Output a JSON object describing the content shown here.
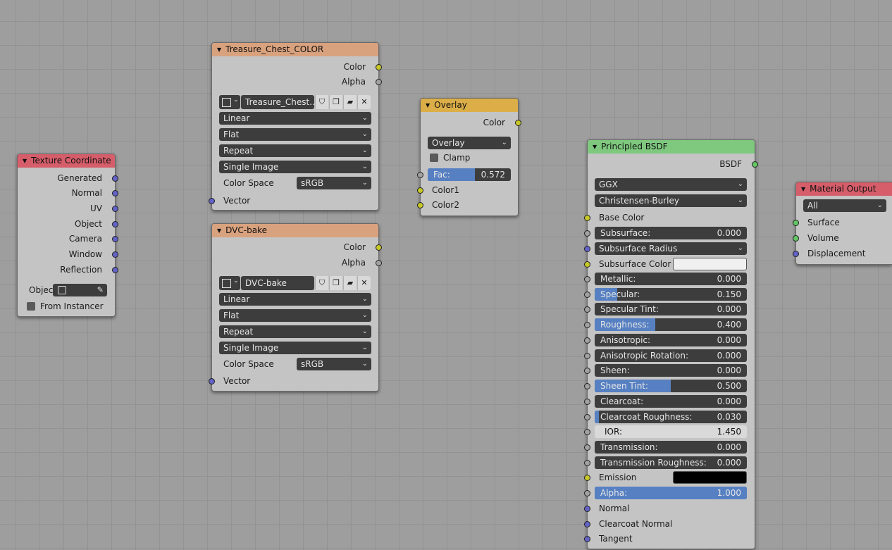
{
  "texcoord": {
    "title": "Texture Coordinate",
    "outputs": [
      "Generated",
      "Normal",
      "UV",
      "Object",
      "Camera",
      "Window",
      "Reflection"
    ],
    "object_label": "Objec",
    "from_instancer": "From Instancer"
  },
  "tex1": {
    "title": "Treasure_Chest_COLOR",
    "out_color": "Color",
    "out_alpha": "Alpha",
    "image_name": "Treasure_Chest..",
    "interpolation": "Linear",
    "projection": "Flat",
    "extension": "Repeat",
    "source": "Single Image",
    "colorspace_label": "Color Space",
    "colorspace": "sRGB",
    "in_vector": "Vector"
  },
  "tex2": {
    "title": "DVC-bake",
    "out_color": "Color",
    "out_alpha": "Alpha",
    "image_name": "DVC-bake",
    "interpolation": "Linear",
    "projection": "Flat",
    "extension": "Repeat",
    "source": "Single Image",
    "colorspace_label": "Color Space",
    "colorspace": "sRGB",
    "in_vector": "Vector"
  },
  "overlay": {
    "title": "Overlay",
    "out_color": "Color",
    "blend": "Overlay",
    "clamp": "Clamp",
    "fac_label": "Fac:",
    "fac_value": "0.572",
    "fac_fraction": 0.572,
    "in_color1": "Color1",
    "in_color2": "Color2"
  },
  "bsdf": {
    "title": "Principled BSDF",
    "out": "BSDF",
    "distribution": "GGX",
    "subsurface_method": "Christensen-Burley",
    "base_color": "Base Color",
    "subsurface_label": "Subsurface:",
    "subsurface": "0.000",
    "subsurface_radius": "Subsurface Radius",
    "subsurface_color": "Subsurface Color",
    "metallic_label": "Metallic:",
    "metallic": "0.000",
    "specular_label": "Specular:",
    "specular": "0.150",
    "specular_fraction": 0.15,
    "specular_tint_label": "Specular Tint:",
    "specular_tint": "0.000",
    "roughness_label": "Roughness:",
    "roughness": "0.400",
    "roughness_fraction": 0.4,
    "anisotropic_label": "Anisotropic:",
    "anisotropic": "0.000",
    "aniso_rot_label": "Anisotropic Rotation:",
    "aniso_rot": "0.000",
    "sheen_label": "Sheen:",
    "sheen": "0.000",
    "sheen_tint_label": "Sheen Tint:",
    "sheen_tint": "0.500",
    "sheen_tint_fraction": 0.5,
    "clearcoat_label": "Clearcoat:",
    "clearcoat": "0.000",
    "clearcoat_rough_label": "Clearcoat Roughness:",
    "clearcoat_rough": "0.030",
    "clearcoat_rough_fraction": 0.03,
    "ior_label": "IOR:",
    "ior": "1.450",
    "transmission_label": "Transmission:",
    "transmission": "0.000",
    "trans_rough_label": "Transmission Roughness:",
    "trans_rough": "0.000",
    "emission": "Emission",
    "alpha_label": "Alpha:",
    "alpha": "1.000",
    "alpha_fraction": 1.0,
    "in_normal": "Normal",
    "in_clearcoat_normal": "Clearcoat Normal",
    "in_tangent": "Tangent"
  },
  "matout": {
    "title": "Material Output",
    "target": "All",
    "in_surface": "Surface",
    "in_volume": "Volume",
    "in_displacement": "Displacement"
  },
  "colors": {
    "header_input": "#d55e6a",
    "header_texture": "#d9a27e",
    "header_color": "#dcae48",
    "header_shader": "#7fc97f",
    "header_output": "#d55e6a",
    "slider_fill": "#5680c2"
  }
}
